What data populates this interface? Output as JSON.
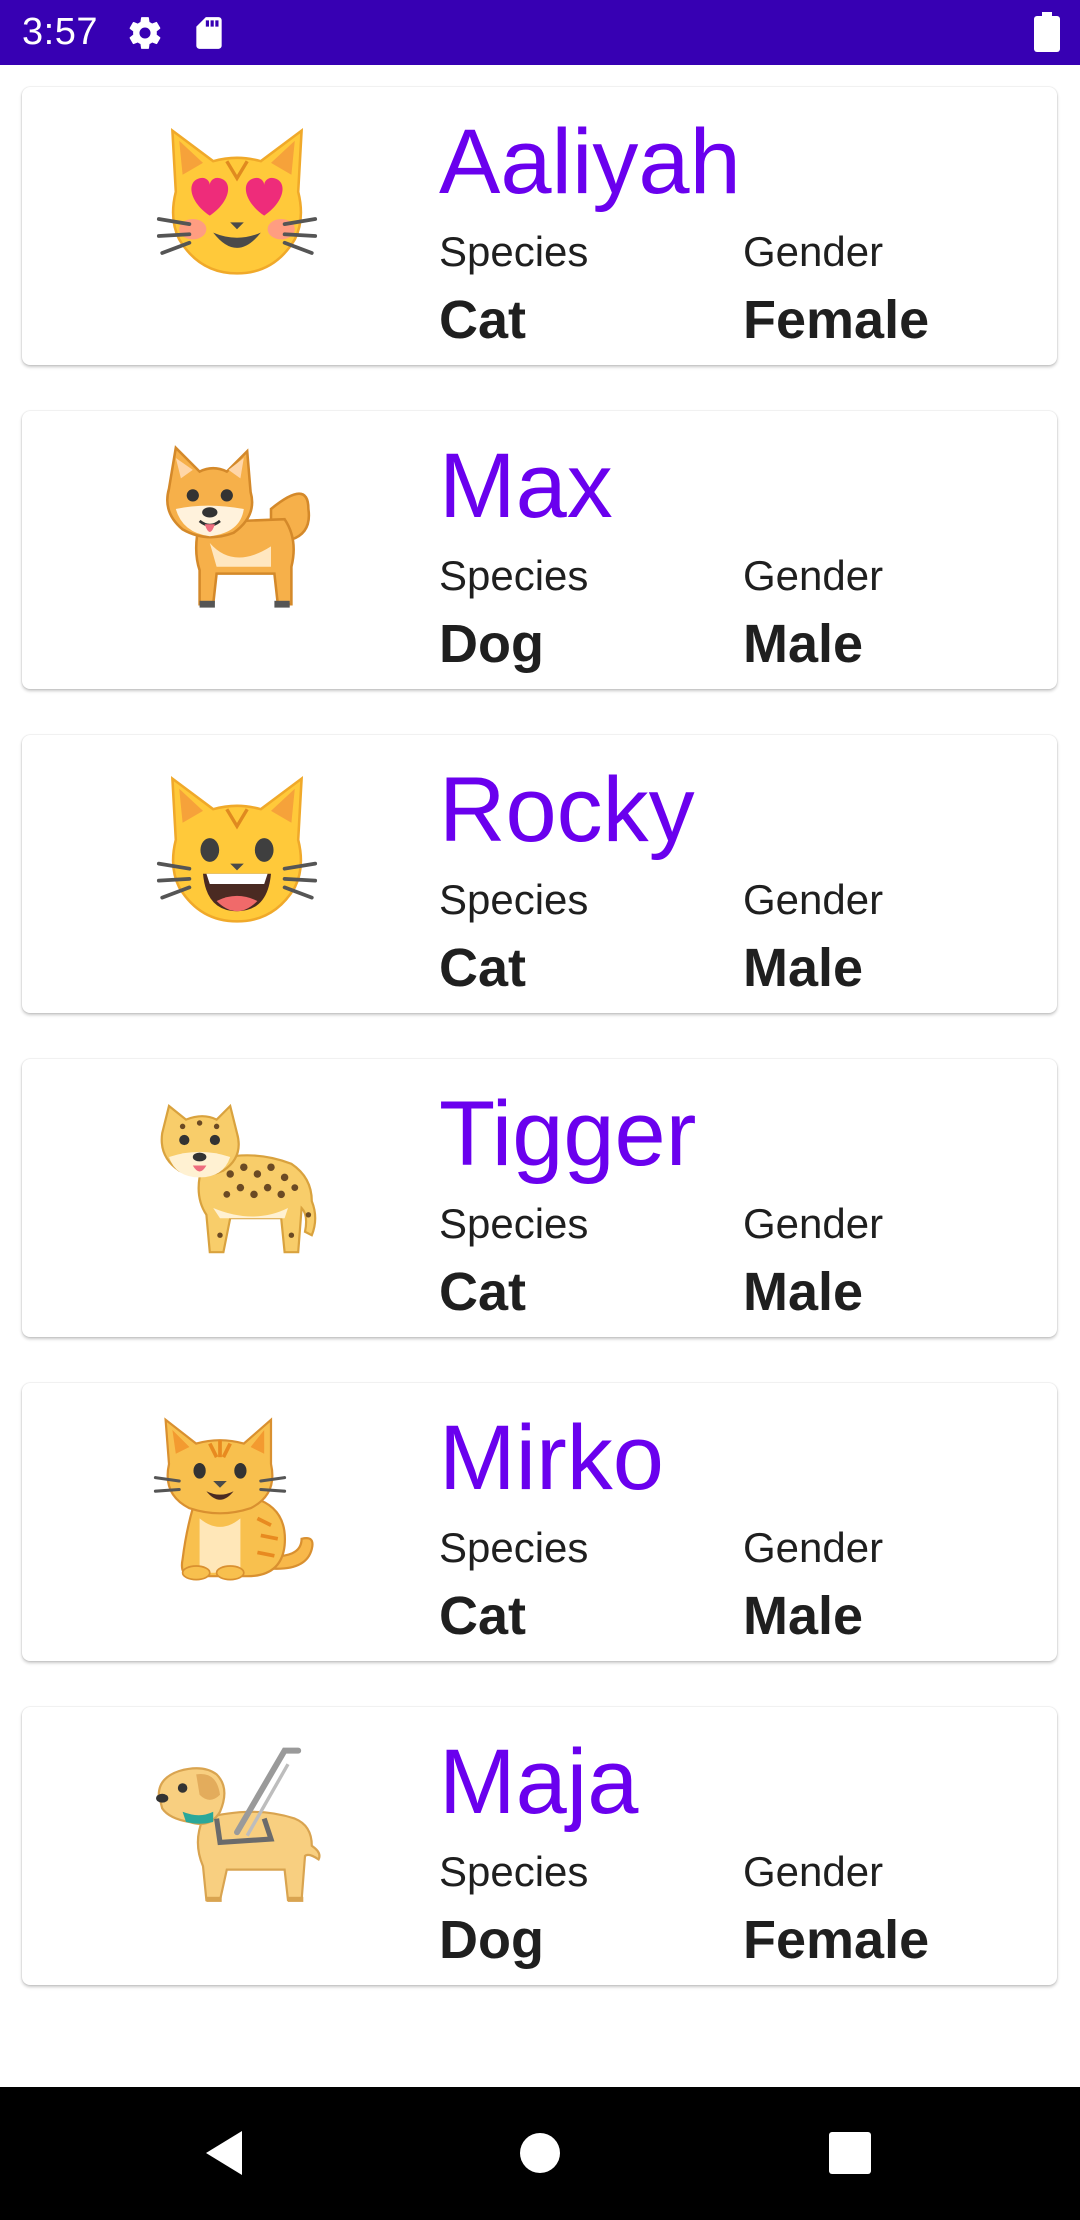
{
  "status_bar": {
    "time": "3:57",
    "icons": [
      "gear-icon",
      "sd-card-icon",
      "battery-icon"
    ],
    "background": "#3700b3"
  },
  "labels": {
    "species": "Species",
    "gender": "Gender"
  },
  "pets": [
    {
      "name": "Aaliyah",
      "species": "Cat",
      "gender": "Female",
      "icon": "smiling-cat-heart-eyes-icon"
    },
    {
      "name": "Max",
      "species": "Dog",
      "gender": "Male",
      "icon": "shiba-dog-icon"
    },
    {
      "name": "Rocky",
      "species": "Cat",
      "gender": "Male",
      "icon": "grinning-cat-icon"
    },
    {
      "name": "Tigger",
      "species": "Cat",
      "gender": "Male",
      "icon": "leopard-icon"
    },
    {
      "name": "Mirko",
      "species": "Cat",
      "gender": "Male",
      "icon": "tabby-cat-icon"
    },
    {
      "name": "Maja",
      "species": "Dog",
      "gender": "Female",
      "icon": "guide-dog-icon"
    }
  ],
  "colors": {
    "accent_name": "#6a00ee",
    "text": "#1f1f1f"
  },
  "nav_bar": {
    "buttons": [
      "back-icon",
      "home-icon",
      "recents-icon"
    ]
  }
}
